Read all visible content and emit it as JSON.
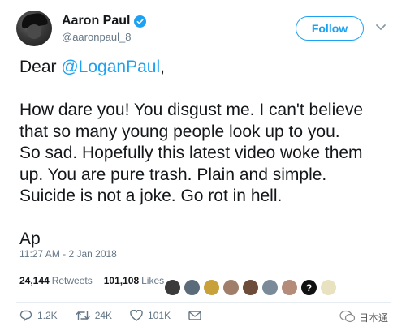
{
  "profile": {
    "name": "Aaron Paul",
    "handle": "@aaronpaul_8",
    "avatar_icon": "profile-photo",
    "verified_icon": "verified-badge-icon"
  },
  "follow_label": "Follow",
  "tweet": {
    "greeting_prefix": "Dear ",
    "mention": "@LoganPaul",
    "greeting_suffix": ",",
    "body_lines": [
      "How dare you! You disgust me. I can't believe",
      "that so many young people look up to you.",
      "So sad. Hopefully this latest video woke them",
      "up. You are pure trash. Plain and simple.",
      "Suicide is not a joke. Go rot in hell."
    ],
    "signature": "Ap"
  },
  "timestamp": "11:27 AM - 2 Jan 2018",
  "stats": {
    "retweets_count": "24,144",
    "retweets_label": "Retweets",
    "likes_count": "101,108",
    "likes_label": "Likes"
  },
  "actions": {
    "reply_count": "1.2K",
    "retweet_count": "24K",
    "like_count": "101K"
  },
  "watermark": "日本通",
  "colors": {
    "accent": "#1da1f2",
    "text": "#14171a",
    "muted": "#657786"
  }
}
